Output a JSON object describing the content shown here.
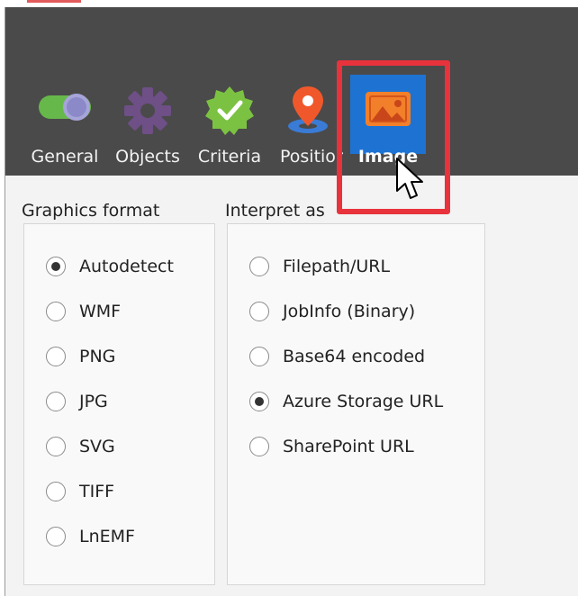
{
  "toolbar": {
    "tabs": [
      {
        "label": "General",
        "icon": "toggle-icon"
      },
      {
        "label": "Objects",
        "icon": "gear-icon"
      },
      {
        "label": "Criteria",
        "icon": "verified-badge-icon"
      },
      {
        "label": "Position",
        "icon": "location-pin-icon"
      },
      {
        "label": "Image",
        "icon": "image-icon",
        "active": true
      }
    ]
  },
  "graphics_format": {
    "title": "Graphics format",
    "options": [
      "Autodetect",
      "WMF",
      "PNG",
      "JPG",
      "SVG",
      "TIFF",
      "LnEMF"
    ],
    "selected": "Autodetect"
  },
  "interpret_as": {
    "title": "Interpret as",
    "options": [
      "Filepath/URL",
      "JobInfo (Binary)",
      "Base64 encoded",
      "Azure Storage URL",
      "SharePoint URL"
    ],
    "selected": "Azure Storage URL"
  },
  "colors": {
    "toolbar_bg": "#4a4a4a",
    "active_tab_bg": "#1e73d2",
    "highlight_border": "#e8323c",
    "toggle_green": "#67b84a",
    "gear_purple": "#6e4f86",
    "badge_green": "#7cc242",
    "pin_orange": "#f0582b",
    "image_orange": "#f27f2a"
  }
}
